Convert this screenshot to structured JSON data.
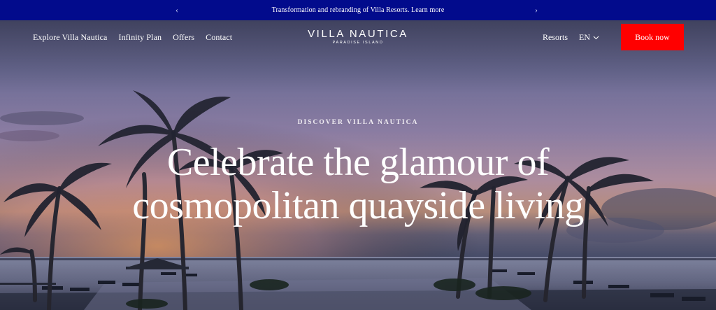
{
  "announcement": {
    "text": "Transformation and rebranding of Villa Resorts. Learn more",
    "prev_icon": "chevron-left-icon",
    "next_icon": "chevron-right-icon",
    "background": "#020b8c"
  },
  "nav": {
    "left_links": [
      "Explore Villa Nautica",
      "Infinity Plan",
      "Offers",
      "Contact"
    ],
    "logo": {
      "name": "VILLA NAUTICA",
      "subtitle": "PARADISE ISLAND"
    },
    "resorts": "Resorts",
    "language": "EN",
    "language_icon": "chevron-down-icon",
    "book_label": "Book now",
    "book_color": "#ff0000"
  },
  "hero": {
    "eyebrow": "DISCOVER VILLA NAUTICA",
    "headline_line1": "Celebrate the glamour of",
    "headline_line2": "cosmopolitan quayside living"
  }
}
